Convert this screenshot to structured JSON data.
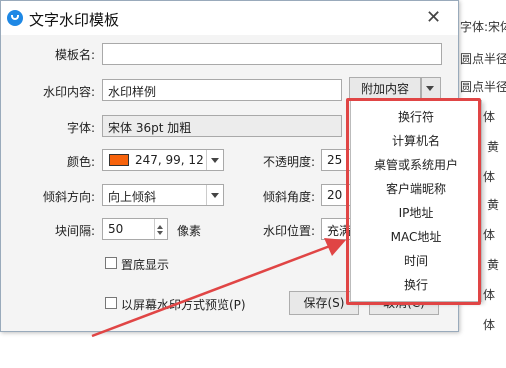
{
  "background": {
    "lines": [
      "字体:宋体",
      "圆点半径",
      "圆点半径",
      "体",
      "黄",
      "体",
      "黄",
      "体",
      "黄",
      "体",
      "体"
    ]
  },
  "dialog": {
    "title": "文字水印模板",
    "close_glyph": "✕",
    "template_name": {
      "label": "模板名:",
      "value": ""
    },
    "watermark_content": {
      "label": "水印内容:",
      "value": "水印样例",
      "append_button": "附加内容"
    },
    "font": {
      "label": "字体:",
      "value": "宋体 36pt 加粗"
    },
    "color": {
      "label": "颜色:",
      "value": "247, 99, 12",
      "swatch": "#f7630c"
    },
    "opacity": {
      "label": "不透明度:",
      "value": "25"
    },
    "tilt_direction": {
      "label": "倾斜方向:",
      "value": "向上倾斜"
    },
    "tilt_angle": {
      "label": "倾斜角度:",
      "value": "20"
    },
    "block_spacing": {
      "label": "块间隔:",
      "value": "50",
      "unit": "像素"
    },
    "watermark_position": {
      "label": "水印位置:",
      "value": "充满"
    },
    "pin_bottom": {
      "label": "置底显示",
      "checked": false
    },
    "fullscreen_preview": {
      "label": "以屏幕水印方式预览(P)",
      "checked": false
    },
    "save_button": "保存(S)",
    "cancel_button": "取消(C)"
  },
  "menu": {
    "items": [
      "换行符",
      "计算机名",
      "桌管或系统用户",
      "客户端昵称",
      "IP地址",
      "MAC地址",
      "时间",
      "换行"
    ]
  },
  "colors": {
    "highlight": "#e04545",
    "arrow": "#e04545"
  }
}
